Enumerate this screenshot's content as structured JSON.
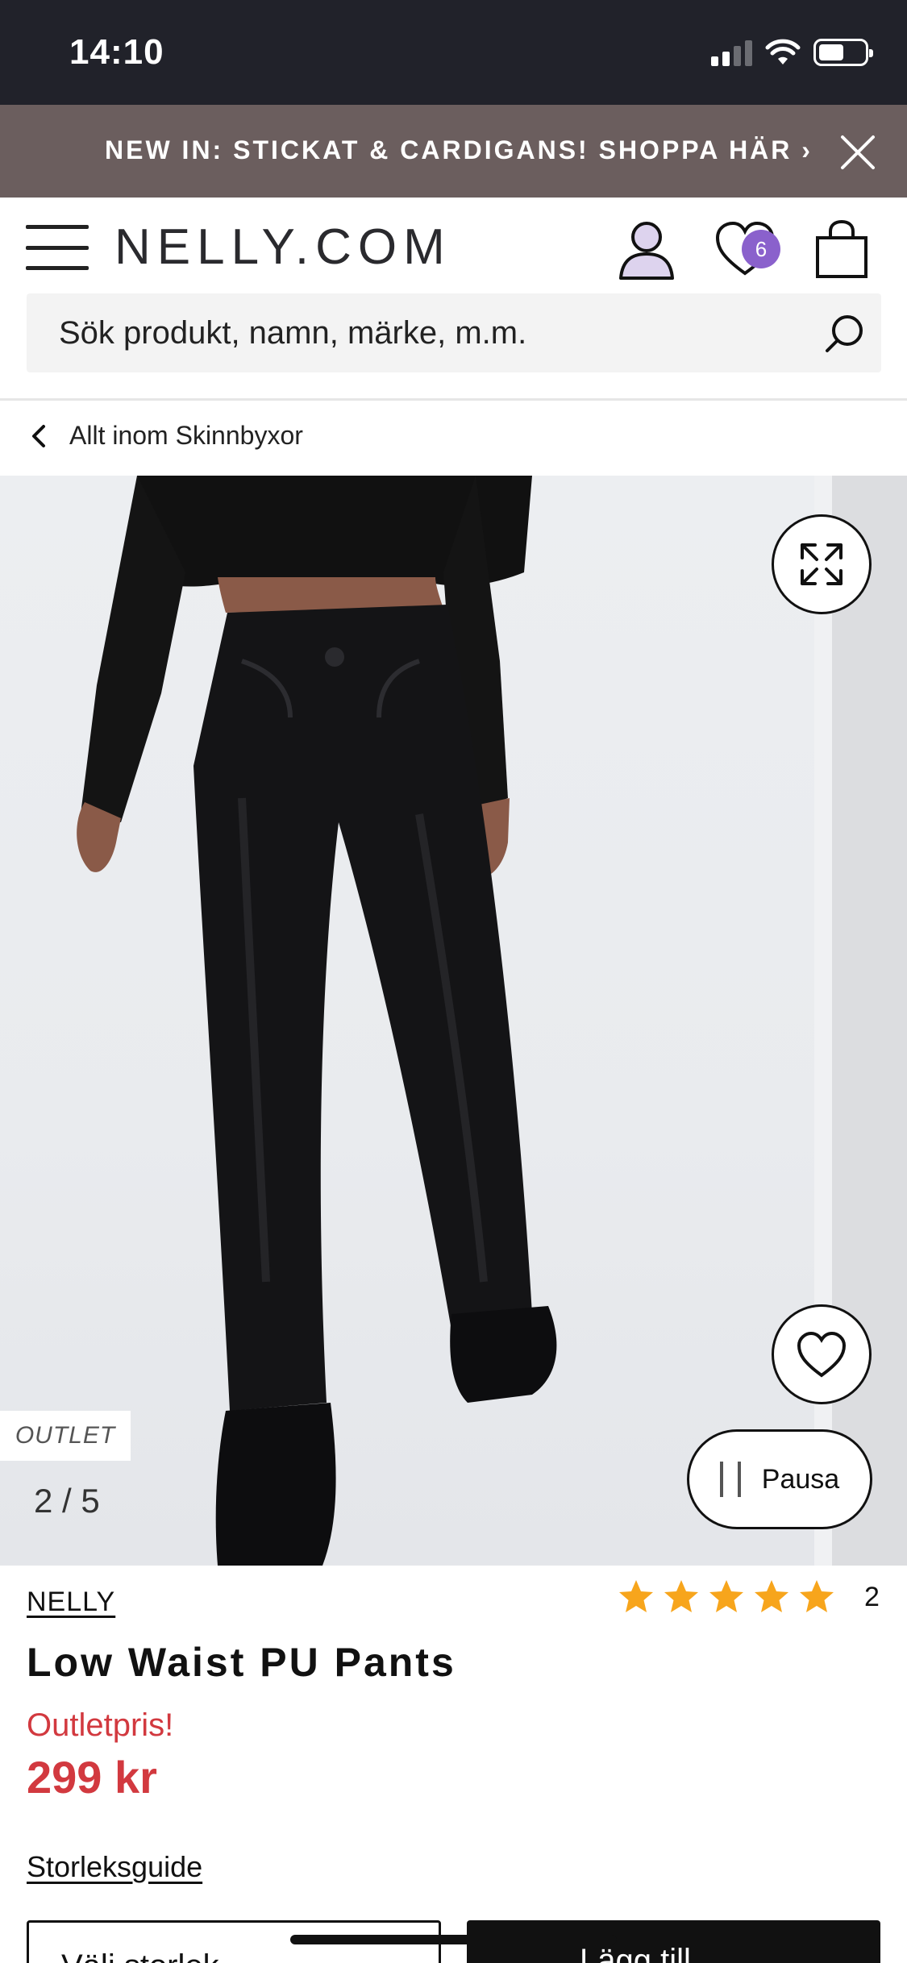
{
  "status_bar": {
    "time": "14:10"
  },
  "promo_banner": {
    "text": "NEW IN: STICKAT & CARDIGANS! SHOPPA HÄR ›"
  },
  "header": {
    "logo": "NELLY.COM",
    "wishlist_count": "6"
  },
  "search": {
    "placeholder": "Sök produkt, namn, märke, m.m."
  },
  "breadcrumb": {
    "label": "Allt inom Skinnbyxor"
  },
  "gallery": {
    "badge": "OUTLET",
    "counter": "2 / 5",
    "pause_label": "Pausa"
  },
  "product": {
    "brand": "NELLY",
    "name": "Low Waist PU Pants",
    "rating": 5,
    "review_count": "2",
    "price_label": "Outletpris!",
    "price": "299 kr",
    "size_guide": "Storleksguide",
    "size_select": "Välj storlek",
    "add_to_cart": "Lägg till"
  },
  "colors": {
    "status_bar": "#21222a",
    "promo_banner": "#6b5e5e",
    "price": "#d2393f",
    "star": "#f7a51c",
    "wishlist_badge": "#8a61cc"
  }
}
